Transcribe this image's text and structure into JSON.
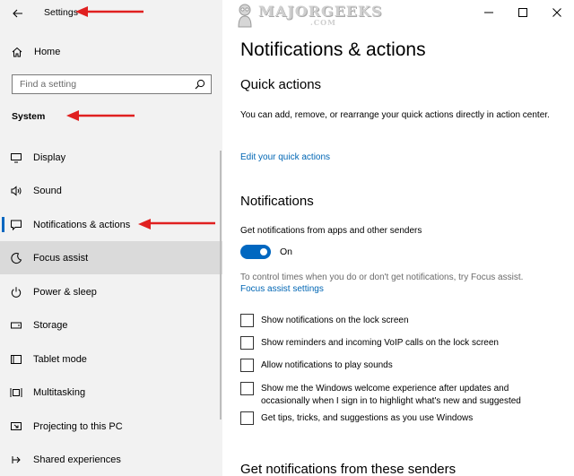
{
  "window": {
    "title": "Settings",
    "controls": [
      "minimize-icon",
      "maximize-icon",
      "close-icon"
    ]
  },
  "watermark": {
    "text": "MAJORGEEKS",
    "sub": ".COM"
  },
  "sidebar": {
    "home_label": "Home",
    "search_placeholder": "Find a setting",
    "section_label": "System",
    "items": [
      {
        "label": "Display",
        "icon": "monitor-icon"
      },
      {
        "label": "Sound",
        "icon": "speaker-icon"
      },
      {
        "label": "Notifications & actions",
        "icon": "message-icon",
        "active": true
      },
      {
        "label": "Focus assist",
        "icon": "moon-icon",
        "hover": true
      },
      {
        "label": "Power & sleep",
        "icon": "power-icon"
      },
      {
        "label": "Storage",
        "icon": "drive-icon"
      },
      {
        "label": "Tablet mode",
        "icon": "tablet-icon"
      },
      {
        "label": "Multitasking",
        "icon": "multitasking-icon"
      },
      {
        "label": "Projecting to this PC",
        "icon": "projector-icon"
      },
      {
        "label": "Shared experiences",
        "icon": "shared-icon"
      }
    ]
  },
  "main": {
    "page_title": "Notifications & actions",
    "quick_actions": {
      "heading": "Quick actions",
      "description": "You can add, remove, or rearrange your quick actions directly in action center.",
      "link": "Edit your quick actions"
    },
    "notifications": {
      "heading": "Notifications",
      "toggle_caption": "Get notifications from apps and other senders",
      "toggle_state": "On",
      "focus_text": "To control times when you do or don't get notifications, try Focus assist.",
      "focus_link": "Focus assist settings",
      "checkboxes": [
        "Show notifications on the lock screen",
        "Show reminders and incoming VoIP calls on the lock screen",
        "Allow notifications to play sounds",
        "Show me the Windows welcome experience after updates and occasionally when I sign in to highlight what's new and suggested",
        "Get tips, tricks, and suggestions as you use Windows"
      ]
    },
    "senders_heading": "Get notifications from these senders"
  },
  "colors": {
    "accent": "#0067c0",
    "link": "#0066b4",
    "sidebar_bg": "#f2f2f2",
    "hover_bg": "#dadada",
    "annotation_arrow": "#e02020"
  }
}
